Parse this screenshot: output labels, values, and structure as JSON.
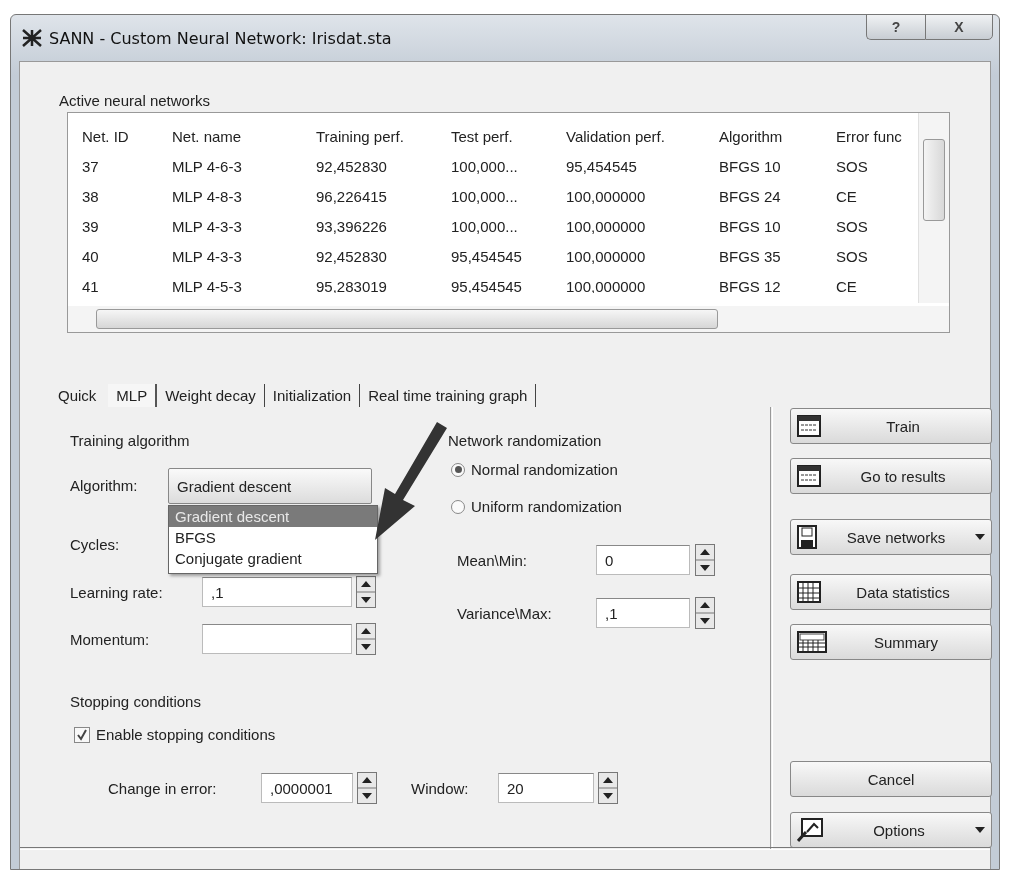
{
  "window": {
    "title": "SANN - Custom Neural Network: Irisdat.sta",
    "caption_buttons": [
      "?",
      "X"
    ]
  },
  "networks": {
    "label": "Active neural networks",
    "columns": [
      "Net. ID",
      "Net. name",
      "Training perf.",
      "Test perf.",
      "Validation perf.",
      "Algorithm",
      "Error func"
    ],
    "rows": [
      [
        "37",
        "MLP 4-6-3",
        "92,452830",
        "100,000...",
        "95,454545",
        "BFGS 10",
        "SOS"
      ],
      [
        "38",
        "MLP 4-8-3",
        "96,226415",
        "100,000...",
        "100,000000",
        "BFGS 24",
        "CE"
      ],
      [
        "39",
        "MLP 4-3-3",
        "93,396226",
        "100,000...",
        "100,000000",
        "BFGS 10",
        "SOS"
      ],
      [
        "40",
        "MLP 4-3-3",
        "92,452830",
        "95,454545",
        "100,000000",
        "BFGS 35",
        "SOS"
      ],
      [
        "41",
        "MLP 4-5-3",
        "95,283019",
        "95,454545",
        "100,000000",
        "BFGS 12",
        "CE"
      ]
    ]
  },
  "tabs": [
    {
      "label": "Quick",
      "selected": false
    },
    {
      "label": "MLP",
      "selected": true
    },
    {
      "label": "Weight decay",
      "selected": false
    },
    {
      "label": "Initialization",
      "selected": false
    },
    {
      "label": "Real time training graph",
      "selected": false
    }
  ],
  "training": {
    "label": "Training algorithm",
    "algorithm_label": "Algorithm:",
    "algorithm_value": "Gradient descent",
    "options": [
      {
        "label": "Gradient descent",
        "selected": true
      },
      {
        "label": "BFGS",
        "selected": false
      },
      {
        "label": "Conjugate gradient",
        "selected": false
      }
    ],
    "cycles_label": "Cycles:",
    "learning_rate": {
      "label": "Learning rate:",
      "value": ",1"
    },
    "momentum": {
      "label": "Momentum:"
    }
  },
  "randomization": {
    "label": "Network randomization",
    "options": [
      {
        "label": "Normal randomization",
        "selected": true
      },
      {
        "label": "Uniform randomization",
        "selected": false
      }
    ],
    "mean": {
      "label": "Mean\\Min:",
      "value": "0"
    },
    "variance": {
      "label": "Variance\\Max:",
      "value": ",1"
    }
  },
  "stopping": {
    "label": "Stopping conditions",
    "enable": {
      "label": "Enable stopping conditions",
      "checked": true
    },
    "change": {
      "label": "Change in error:",
      "value": ",0000001"
    },
    "window": {
      "label": "Window:",
      "value": "20"
    }
  },
  "actions": [
    {
      "label": "Train",
      "kind": "sheet",
      "menu": false
    },
    {
      "label": "Go to results",
      "kind": "sheet",
      "menu": false
    },
    {
      "label": "Save networks",
      "kind": "save",
      "menu": true
    },
    {
      "label": "Data statistics",
      "kind": "grid",
      "menu": false
    },
    {
      "label": "Summary",
      "kind": "summary",
      "menu": false
    }
  ],
  "footer_buttons": [
    {
      "label": "Cancel",
      "kind": "plain",
      "menu": false
    },
    {
      "label": "Options",
      "kind": "options",
      "menu": true
    }
  ]
}
